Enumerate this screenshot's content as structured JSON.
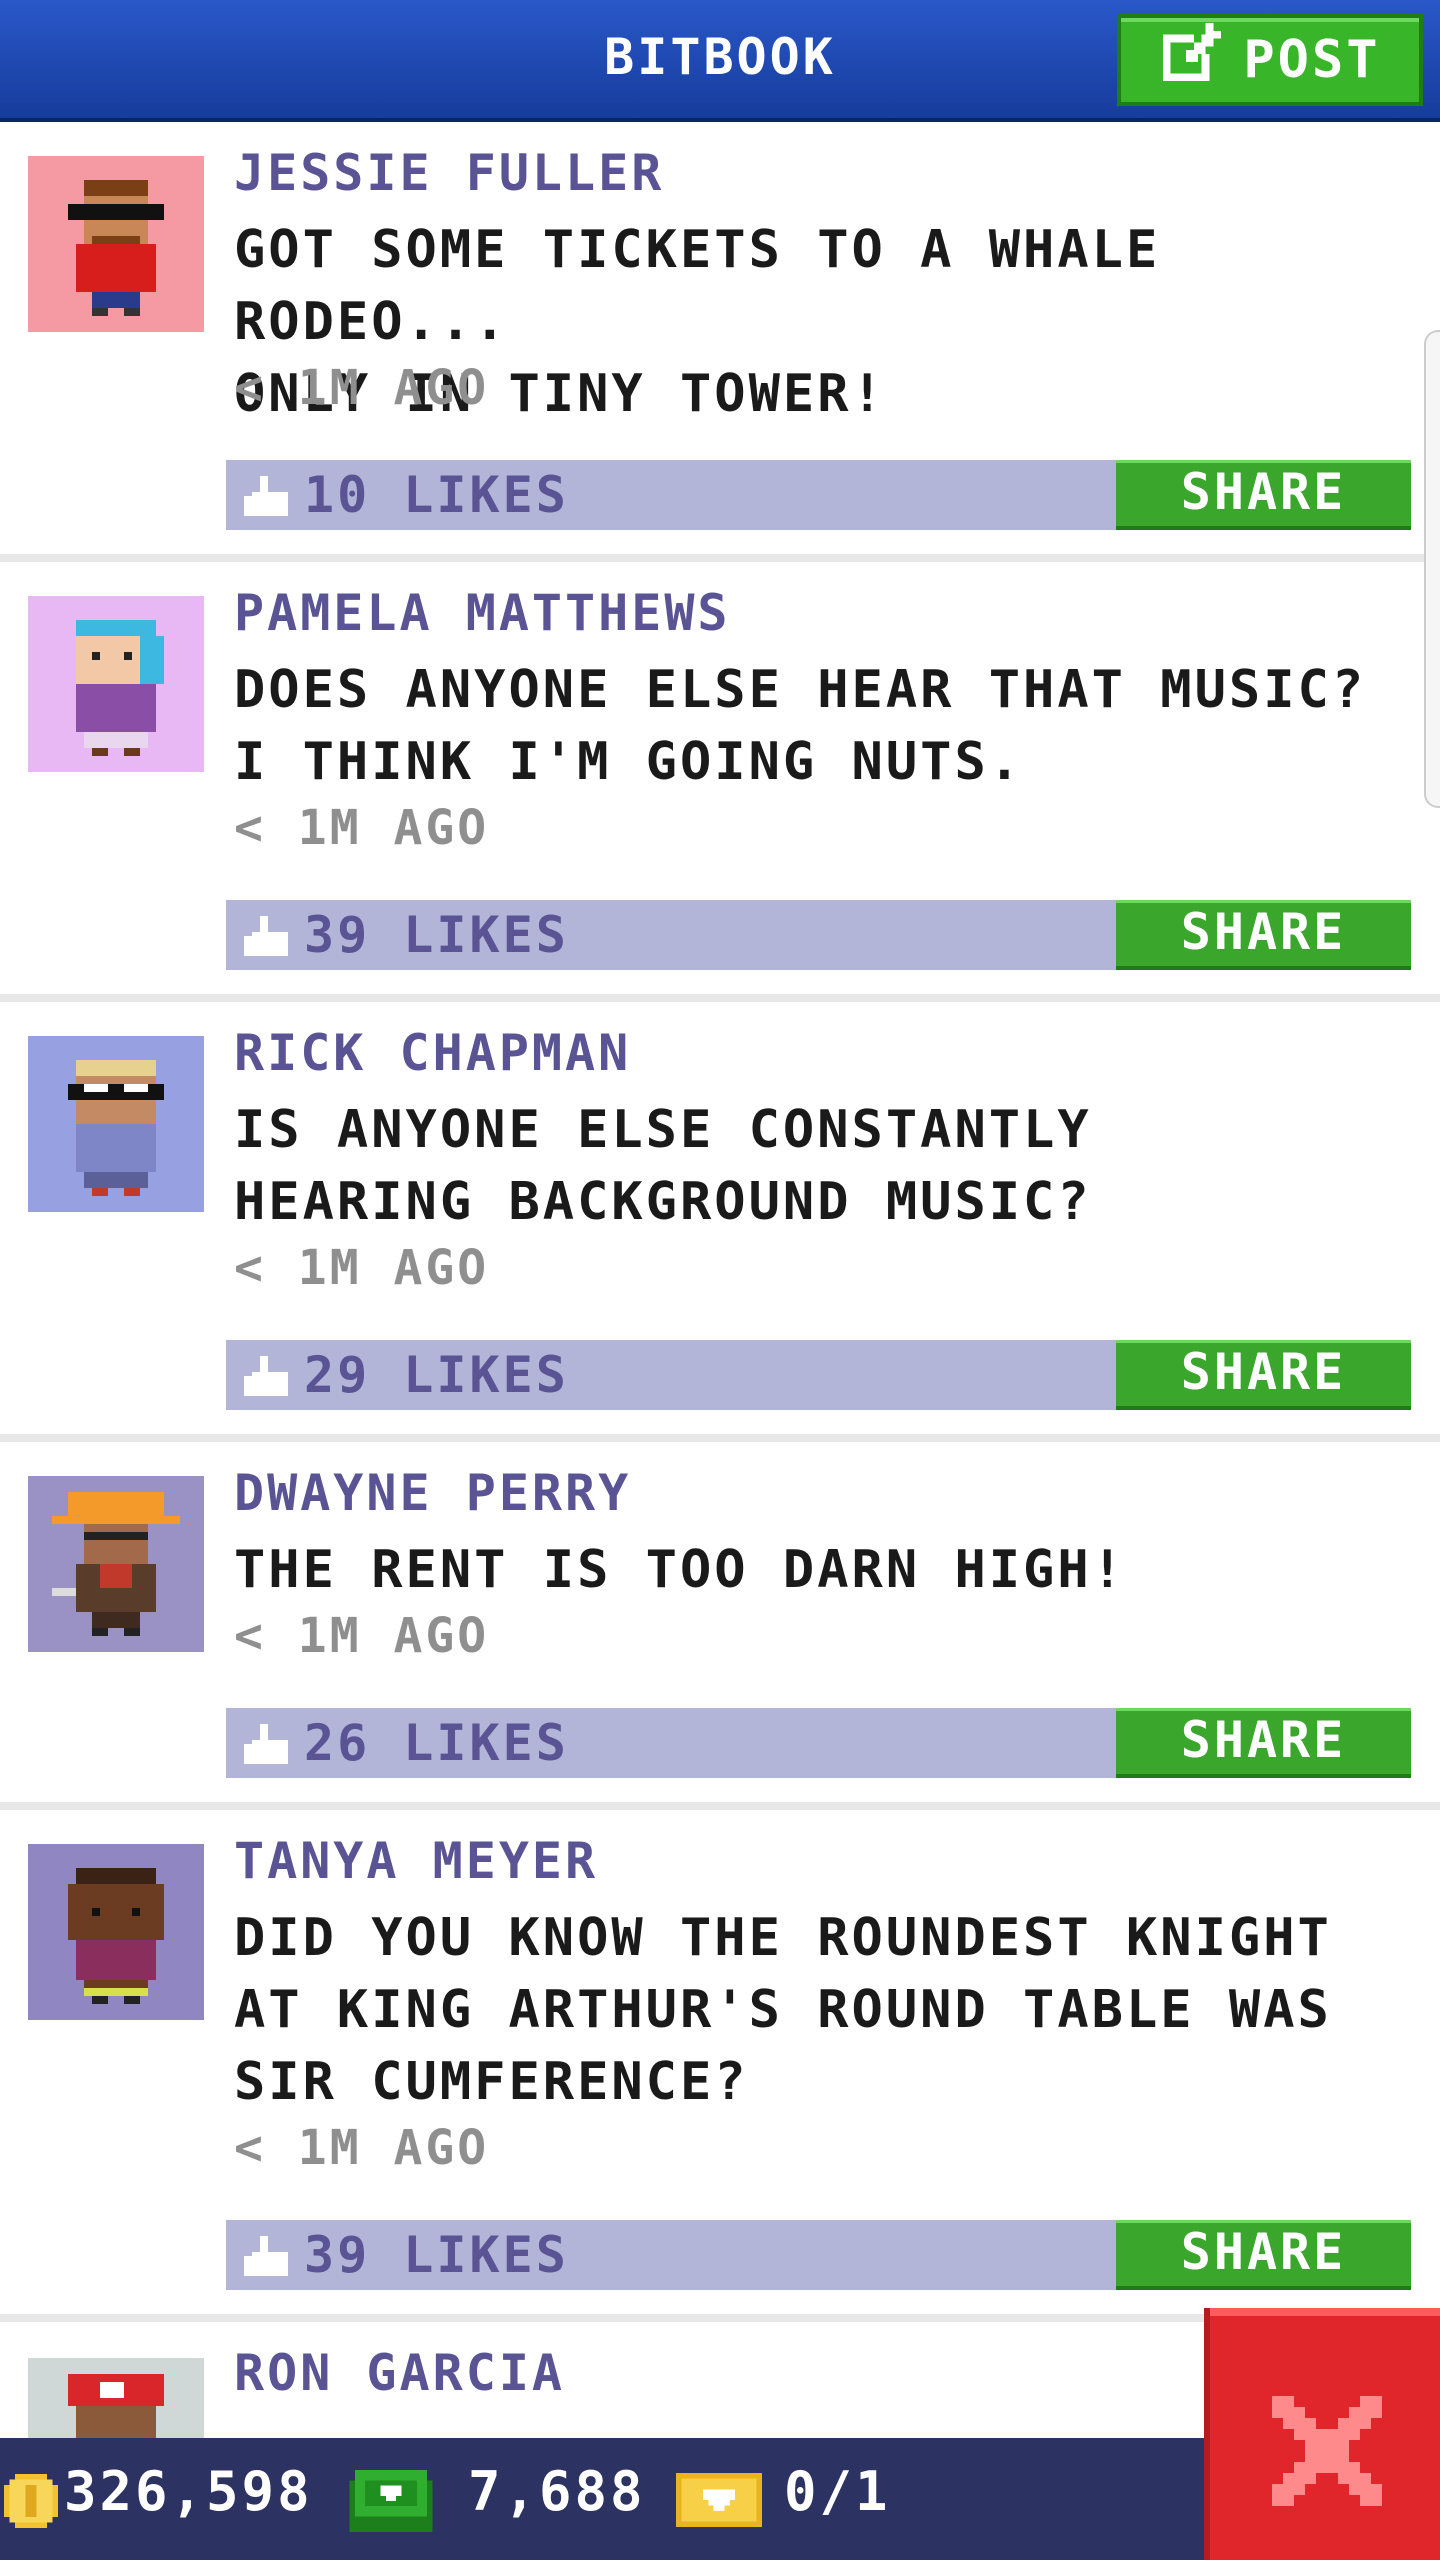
{
  "header": {
    "title": "BITBOOK",
    "post_label": "POST"
  },
  "feed": {
    "posts": [
      {
        "name": "JESSIE FULLER",
        "message": "GOT SOME TICKETS TO A WHALE RODEO...\nONLY IN TINY TOWER!",
        "time": "< 1M AGO",
        "likes": "10 LIKES",
        "share_label": "SHARE",
        "avatar_bg": "#f59aa3"
      },
      {
        "name": "PAMELA MATTHEWS",
        "message": "DOES ANYONE ELSE HEAR THAT MUSIC?\nI THINK I'M GOING NUTS.",
        "time": "< 1M AGO",
        "likes": "39 LIKES",
        "share_label": "SHARE",
        "avatar_bg": "#e7b8f4"
      },
      {
        "name": "RICK CHAPMAN",
        "message": "IS ANYONE ELSE CONSTANTLY\nHEARING BACKGROUND MUSIC?",
        "time": "< 1M AGO",
        "likes": "29 LIKES",
        "share_label": "SHARE",
        "avatar_bg": "#97a0e0"
      },
      {
        "name": "DWAYNE PERRY",
        "message": "THE RENT IS TOO DARN HIGH!",
        "time": "< 1M AGO",
        "likes": "26 LIKES",
        "share_label": "SHARE",
        "avatar_bg": "#9a92c4"
      },
      {
        "name": "TANYA MEYER",
        "message": "DID YOU KNOW THE ROUNDEST KNIGHT\nAT KING ARTHUR'S ROUND TABLE WAS\nSIR CUMFERENCE?",
        "time": "< 1M AGO",
        "likes": "39 LIKES",
        "share_label": "SHARE",
        "avatar_bg": "#8f86c2"
      },
      {
        "name": "RON GARCIA",
        "avatar_bg": "#cfd8d6"
      }
    ]
  },
  "statusbar": {
    "coins": "326,598",
    "bux": "7,688",
    "tickets": "0/1"
  },
  "colors": {
    "header": "#1f4ab3",
    "post_button": "#39b52a",
    "share_button": "#3aa62c",
    "like_bar": "#b3b5d8",
    "name_text": "#5a5494",
    "status_bar": "#2c3261",
    "close_button": "#e0262a"
  },
  "icons": {
    "post": "edit-icon",
    "like": "thumbs-up-icon",
    "coin": "coin-icon",
    "bux": "bux-icon",
    "ticket": "golden-ticket-icon",
    "close": "close-icon"
  }
}
